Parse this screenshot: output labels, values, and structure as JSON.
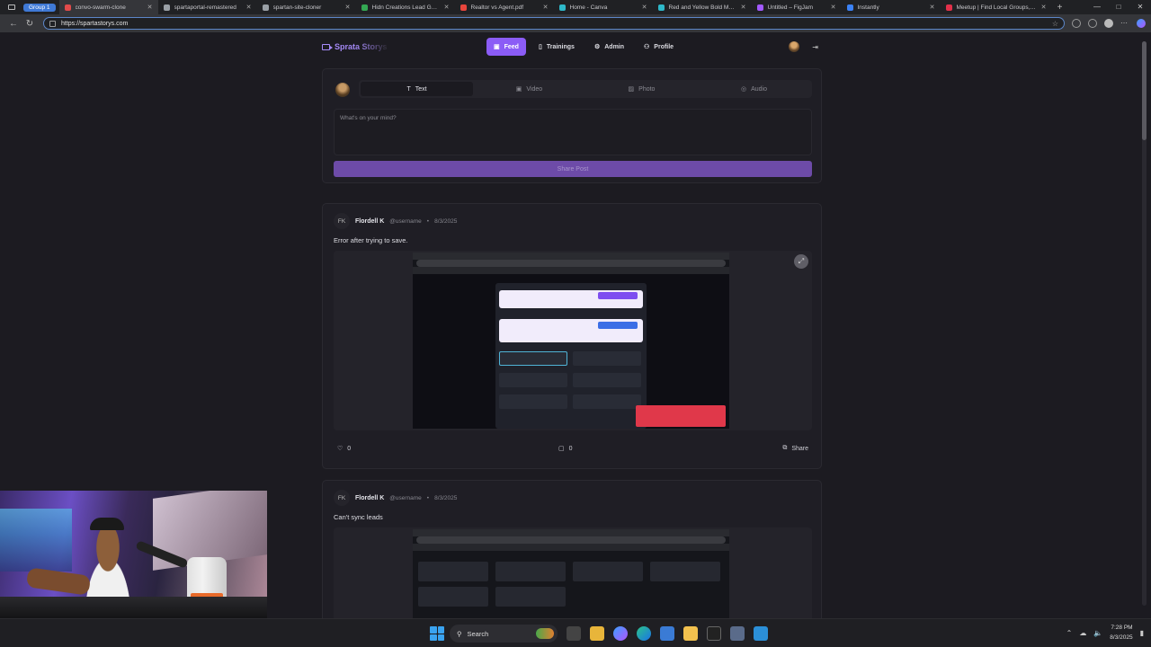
{
  "browser": {
    "tab_group": "Group 1",
    "tabs": [
      {
        "title": "convo-swarm-clone",
        "color": "#e14b4b",
        "active": true
      },
      {
        "title": "spartaportal-remastered",
        "color": "#9aa0a6",
        "active": false
      },
      {
        "title": "spartan-site-cloner",
        "color": "#9aa0a6",
        "active": false
      },
      {
        "title": "Hidn Creations Lead Generator",
        "color": "#34a853",
        "active": false
      },
      {
        "title": "Realtor vs Agent.pdf",
        "color": "#e8453c",
        "active": false
      },
      {
        "title": "Home - Canva",
        "color": "#2eb8c9",
        "active": false
      },
      {
        "title": "Red and Yellow Bold Modern",
        "color": "#2eb8c9",
        "active": false
      },
      {
        "title": "Untitled – FigJam",
        "color": "#a259ff",
        "active": false
      },
      {
        "title": "Instantly",
        "color": "#3b82f6",
        "active": false
      },
      {
        "title": "Meetup | Find Local Groups, Ev",
        "color": "#e2304a",
        "active": false
      }
    ],
    "url": "https://spartastorys.com"
  },
  "app": {
    "brand": "Sprata Storys",
    "nav": [
      {
        "label": "Feed",
        "icon": "video-icon",
        "active": true
      },
      {
        "label": "Trainings",
        "icon": "book-icon",
        "active": false
      },
      {
        "label": "Admin",
        "icon": "gear-icon",
        "active": false
      },
      {
        "label": "Profile",
        "icon": "user-icon",
        "active": false
      }
    ]
  },
  "composer": {
    "tabs": [
      {
        "label": "Text",
        "icon": "text-icon",
        "active": true
      },
      {
        "label": "Video",
        "icon": "video-icon",
        "active": false
      },
      {
        "label": "Photo",
        "icon": "image-icon",
        "active": false
      },
      {
        "label": "Audio",
        "icon": "mic-icon",
        "active": false
      }
    ],
    "placeholder": "What's on your mind?",
    "submit_label": "Share Post"
  },
  "posts": [
    {
      "initials": "FK",
      "author": "Flordell K",
      "handle": "@username",
      "date": "8/3/2025",
      "body": "Error after trying to save.",
      "likes": "0",
      "comments": "0",
      "share_label": "Share"
    },
    {
      "initials": "FK",
      "author": "Flordell K",
      "handle": "@username",
      "date": "8/3/2025",
      "body": "Can't sync leads"
    }
  ],
  "taskbar": {
    "search_label": "Search",
    "time": "7:28 PM",
    "date": "8/3/2025"
  },
  "colors": {
    "accent": "#8b5cf6",
    "background": "#1c1b21",
    "card": "#1f1e25",
    "error_toast": "#e0384a"
  }
}
